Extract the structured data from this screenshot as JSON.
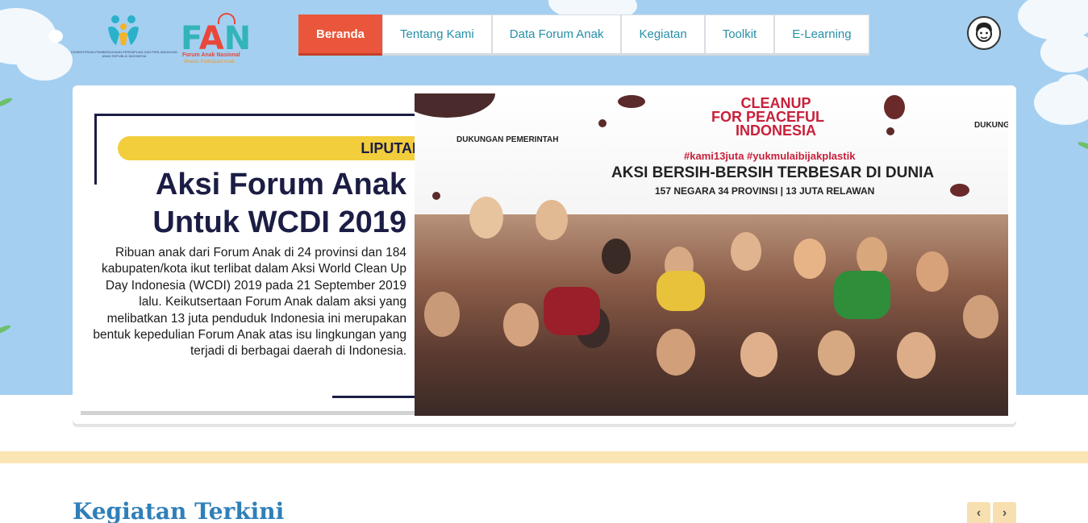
{
  "colors": {
    "sky": "#a4cff0",
    "nav_active": "#e9563b",
    "nav_text": "#2790a8",
    "accent_stripe": "#fbe5b4",
    "section_title": "#2f7fb9",
    "tag_yellow": "#f2cd3c",
    "headline_navy": "#1b1d44"
  },
  "header": {
    "logo_kpp_text": "KEMENTERIAN PEMBERDAYAAN PEREMPUAN DAN PERLINDUNGAN ANAK REPUBLIK INDONESIA",
    "logo_fan": {
      "mark_f": "F",
      "mark_a": "A",
      "mark_n": "N",
      "line1": "Forum Anak Nasional",
      "line2": "Wadah Partisipasi Anak"
    },
    "nav": [
      {
        "label": "Beranda",
        "active": true
      },
      {
        "label": "Tentang Kami",
        "active": false
      },
      {
        "label": "Data Forum Anak",
        "active": false
      },
      {
        "label": "Kegiatan",
        "active": false
      },
      {
        "label": "Toolkit",
        "active": false
      },
      {
        "label": "E-Learning",
        "active": false
      }
    ],
    "avatar_icon": "user-avatar-icon"
  },
  "slide": {
    "tag": "LIPUTAN",
    "headline_line1": "Aksi Forum Anak",
    "headline_line2": "Untuk WCDI 2019",
    "summary": "Ribuan anak dari Forum Anak di 24 provinsi dan 184 kabupaten/kota ikut terlibat dalam Aksi World Clean Up Day Indonesia (WCDI) 2019 pada 21 September 2019 lalu. Keikutsertaan Forum Anak dalam aksi yang melibatkan 13 juta penduduk Indonesia ini merupakan bentuk kepedulian Forum Anak atas isu lingkungan yang terjadi di berbagai daerah di Indonesia.",
    "photo": {
      "banner_title_1": "CLEANUP",
      "banner_title_2": "FOR PEACEFUL",
      "banner_title_3": "INDONESIA",
      "hashtags": "#kami13juta #yukmulaibijakplastik",
      "main_text": "AKSI BERSIH-BERSIH TERBESAR DI DUNIA",
      "sub_text": "157 NEGARA 34 PROVINSI | 13 JUTA RELAWAN",
      "left_label": "DUKUNGAN PEMERINTAH",
      "right_label": "DUKUNG"
    }
  },
  "section": {
    "title": "Kegiatan Terkini",
    "prev_label": "‹",
    "next_label": "›"
  }
}
